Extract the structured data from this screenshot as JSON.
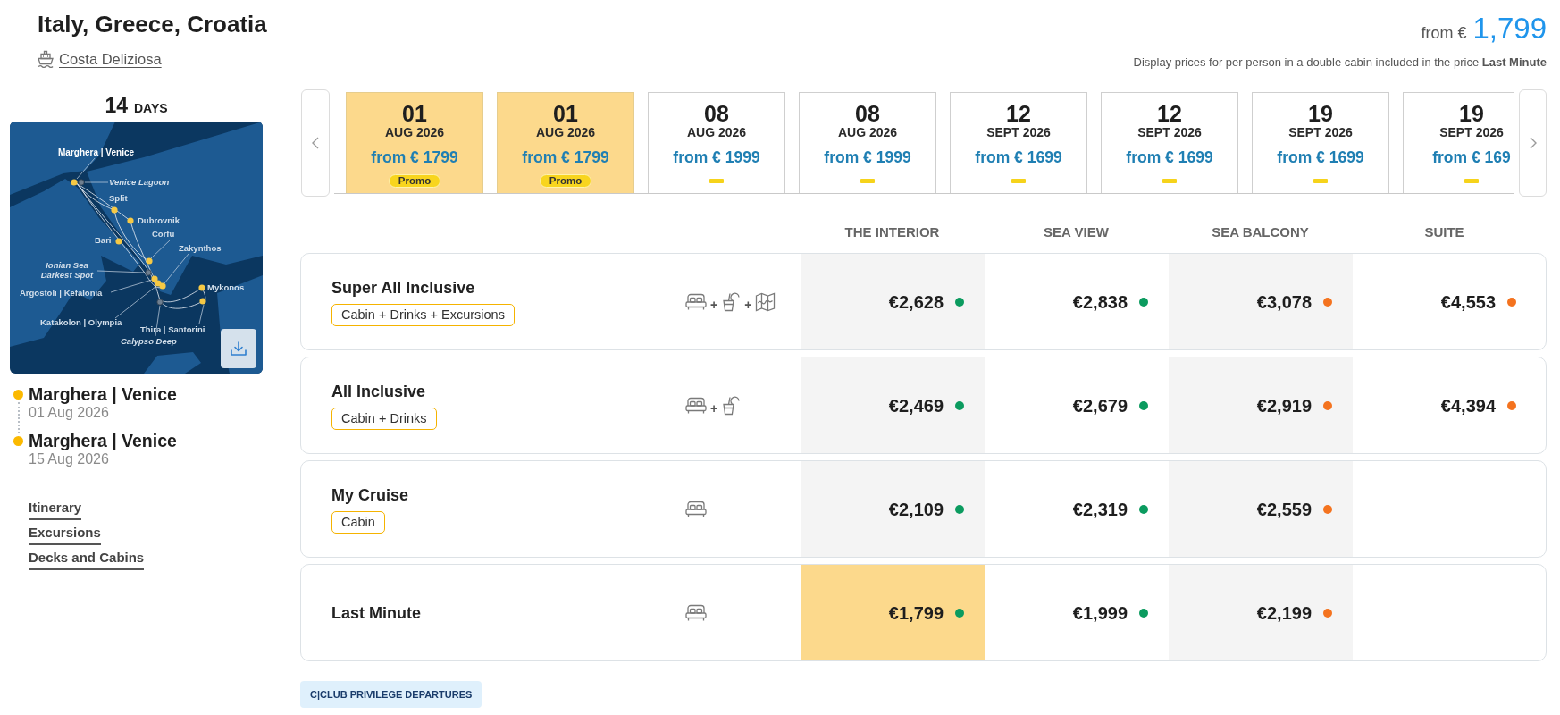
{
  "header": {
    "title": "Italy, Greece, Croatia",
    "ship": "Costa Deliziosa",
    "from_label": "from €",
    "price": "1,799",
    "note": "Display prices for per person in a double cabin included in the price **Last Minute**"
  },
  "duration": {
    "value": "14",
    "unit": "DAYS"
  },
  "map": {
    "labels": [
      {
        "text": "Marghera | Venice",
        "kind": "home"
      },
      {
        "text": "Venice Lagoon",
        "kind": "sea"
      },
      {
        "text": "Split",
        "kind": "port"
      },
      {
        "text": "Dubrovnik",
        "kind": "port"
      },
      {
        "text": "Corfu",
        "kind": "port"
      },
      {
        "text": "Bari",
        "kind": "port"
      },
      {
        "text": "Zakynthos",
        "kind": "port"
      },
      {
        "text": "Ionian Sea Darkest Spot",
        "kind": "sea"
      },
      {
        "text": "Argostoli | Kefalonia",
        "kind": "port"
      },
      {
        "text": "Mykonos",
        "kind": "port"
      },
      {
        "text": "Katakolon | Olympia",
        "kind": "port"
      },
      {
        "text": "Thira | Santorini",
        "kind": "port"
      },
      {
        "text": "Calypso Deep",
        "kind": "sea"
      }
    ]
  },
  "route": [
    {
      "port": "Marghera | Venice",
      "date": "01 Aug 2026"
    },
    {
      "port": "Marghera | Venice",
      "date": "15 Aug 2026"
    }
  ],
  "links": [
    "Itinerary",
    "Excursions",
    "Decks and Cabins"
  ],
  "departures": [
    {
      "day": "01",
      "month": "AUG 2026",
      "price": "from € 1799",
      "badge": "Promo",
      "selected": true
    },
    {
      "day": "01",
      "month": "AUG 2026",
      "price": "from € 1799",
      "badge": "Promo",
      "selected": true
    },
    {
      "day": "08",
      "month": "AUG 2026",
      "price": "from € 1999",
      "selected": false
    },
    {
      "day": "08",
      "month": "AUG 2026",
      "price": "from € 1999",
      "selected": false
    },
    {
      "day": "12",
      "month": "SEPT 2026",
      "price": "from € 1699",
      "selected": false
    },
    {
      "day": "12",
      "month": "SEPT 2026",
      "price": "from € 1699",
      "selected": false
    },
    {
      "day": "19",
      "month": "SEPT 2026",
      "price": "from € 1699",
      "selected": false
    },
    {
      "day": "19",
      "month": "SEPT 2026",
      "price": "from € 169",
      "selected": false
    }
  ],
  "cabin_columns": [
    "THE INTERIOR",
    "SEA VIEW",
    "SEA BALCONY",
    "SUITE"
  ],
  "packages": [
    {
      "name": "Super All Inclusive",
      "tag": "Cabin + Drinks + Excursions",
      "inclusions": [
        {
          "kind": "cabin"
        },
        {
          "kind": "drinks",
          "joiner": "+"
        },
        {
          "kind": "excursions",
          "joiner": "+"
        }
      ],
      "prices": [
        {
          "value": "€2,628",
          "color": "#0b9b5f",
          "selected": false
        },
        {
          "value": "€2,838",
          "color": "#0b9b5f",
          "selected": false
        },
        {
          "value": "€3,078",
          "color": "#f4731f",
          "selected": false
        },
        {
          "value": "€4,553",
          "color": "#f4731f",
          "selected": false
        }
      ]
    },
    {
      "name": "All Inclusive",
      "tag": "Cabin + Drinks",
      "inclusions": [
        {
          "kind": "cabin"
        },
        {
          "kind": "drinks",
          "joiner": "+"
        }
      ],
      "prices": [
        {
          "value": "€2,469",
          "color": "#0b9b5f",
          "selected": false
        },
        {
          "value": "€2,679",
          "color": "#0b9b5f",
          "selected": false
        },
        {
          "value": "€2,919",
          "color": "#f4731f",
          "selected": false
        },
        {
          "value": "€4,394",
          "color": "#f4731f",
          "selected": false
        }
      ]
    },
    {
      "name": "My Cruise",
      "tag": "Cabin",
      "inclusions": [
        {
          "kind": "cabin"
        }
      ],
      "prices": [
        {
          "value": "€2,109",
          "color": "#0b9b5f",
          "selected": false
        },
        {
          "value": "€2,319",
          "color": "#0b9b5f",
          "selected": false
        },
        {
          "value": "€2,559",
          "color": "#f4731f",
          "selected": false
        }
      ]
    },
    {
      "name": "Last Minute",
      "inclusions": [
        {
          "kind": "cabin"
        }
      ],
      "prices": [
        {
          "value": "€1,799",
          "color": "#0b9b5f",
          "selected": true
        },
        {
          "value": "€1,999",
          "color": "#0b9b5f",
          "selected": false
        },
        {
          "value": "€2,199",
          "color": "#f4731f",
          "selected": false
        }
      ]
    }
  ],
  "club_badge": "C|CLUB PRIVILEGE DEPARTURES"
}
